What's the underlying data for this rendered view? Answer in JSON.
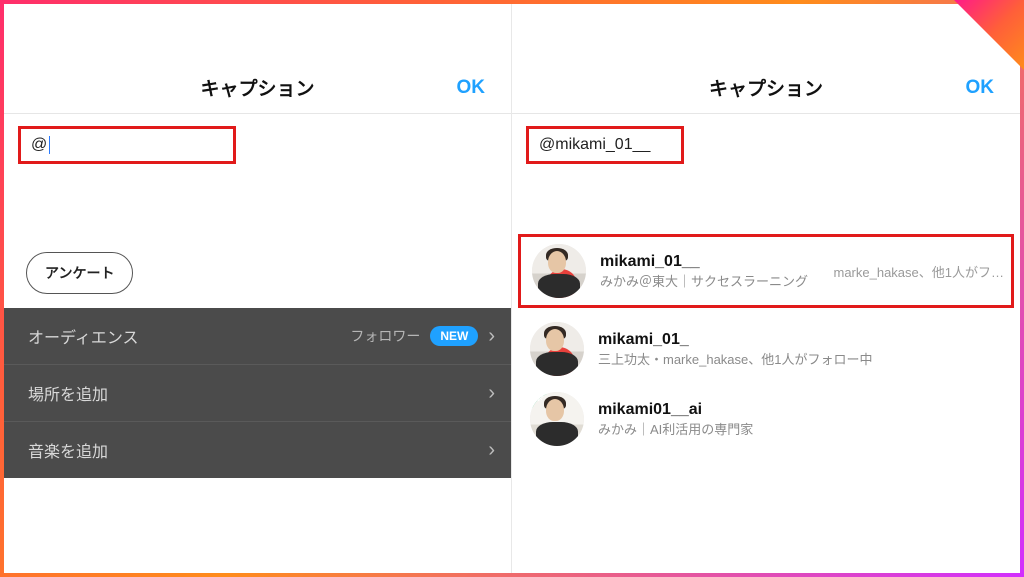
{
  "left": {
    "title": "キャプション",
    "ok": "OK",
    "caption_value": "@",
    "survey_label": "アンケート",
    "list": {
      "audience": {
        "label": "オーディエンス",
        "sub": "フォロワー",
        "badge": "NEW"
      },
      "add_location": {
        "label": "場所を追加"
      },
      "add_music": {
        "label": "音楽を追加"
      }
    }
  },
  "right": {
    "title": "キャプション",
    "ok": "OK",
    "caption_value": "@mikami_01__",
    "suggestions": {
      "s0": {
        "username": "mikami_01__",
        "subtitle": "みかみ＠東大｜サクセスラーニング",
        "tail": "marke_hakase、他1人がフ…"
      },
      "s1": {
        "username": "mikami_01_",
        "subtitle": "三上功太・marke_hakase、他1人がフォロー中"
      },
      "s2": {
        "username": "mikami01__ai",
        "subtitle": "みかみ｜AI利活用の専門家"
      }
    }
  }
}
